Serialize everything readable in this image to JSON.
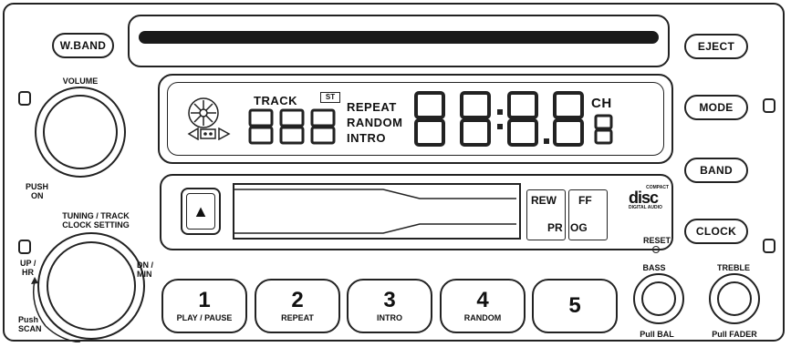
{
  "buttons": {
    "wband": "W.BAND",
    "eject": "EJECT",
    "mode": "MODE",
    "band": "BAND",
    "clock": "CLOCK"
  },
  "labels": {
    "volume": "VOLUME",
    "push": "PUSH",
    "on": "ON",
    "tuning_line1": "TUNING / TRACK",
    "tuning_line2": "CLOCK SETTING",
    "up": "UP /",
    "hr": "HR",
    "dn": "DN /",
    "min": "MIN",
    "push_scan_1": "Push",
    "push_scan_2": "SCAN",
    "reset": "RESET",
    "bass": "BASS",
    "treble": "TREBLE",
    "pull_bal": "Pull BAL",
    "pull_fader": "Pull FADER"
  },
  "display": {
    "track": "TRACK",
    "st": "ST",
    "repeat": "REPEAT",
    "random": "RANDOM",
    "intro": "INTRO",
    "ch": "CH"
  },
  "cassette": {
    "eject_symbol": "▲",
    "rew": "REW",
    "ff": "FF",
    "prog_left": "PR",
    "prog_right": "OG"
  },
  "logo": {
    "compact": "COMPACT",
    "disc": "disc",
    "digital_audio": "DIGITAL AUDIO"
  },
  "presets": [
    {
      "num": "1",
      "label": "PLAY / PAUSE"
    },
    {
      "num": "2",
      "label": "REPEAT"
    },
    {
      "num": "3",
      "label": "INTRO"
    },
    {
      "num": "4",
      "label": "RANDOM"
    },
    {
      "num": "5",
      "label": ""
    }
  ]
}
